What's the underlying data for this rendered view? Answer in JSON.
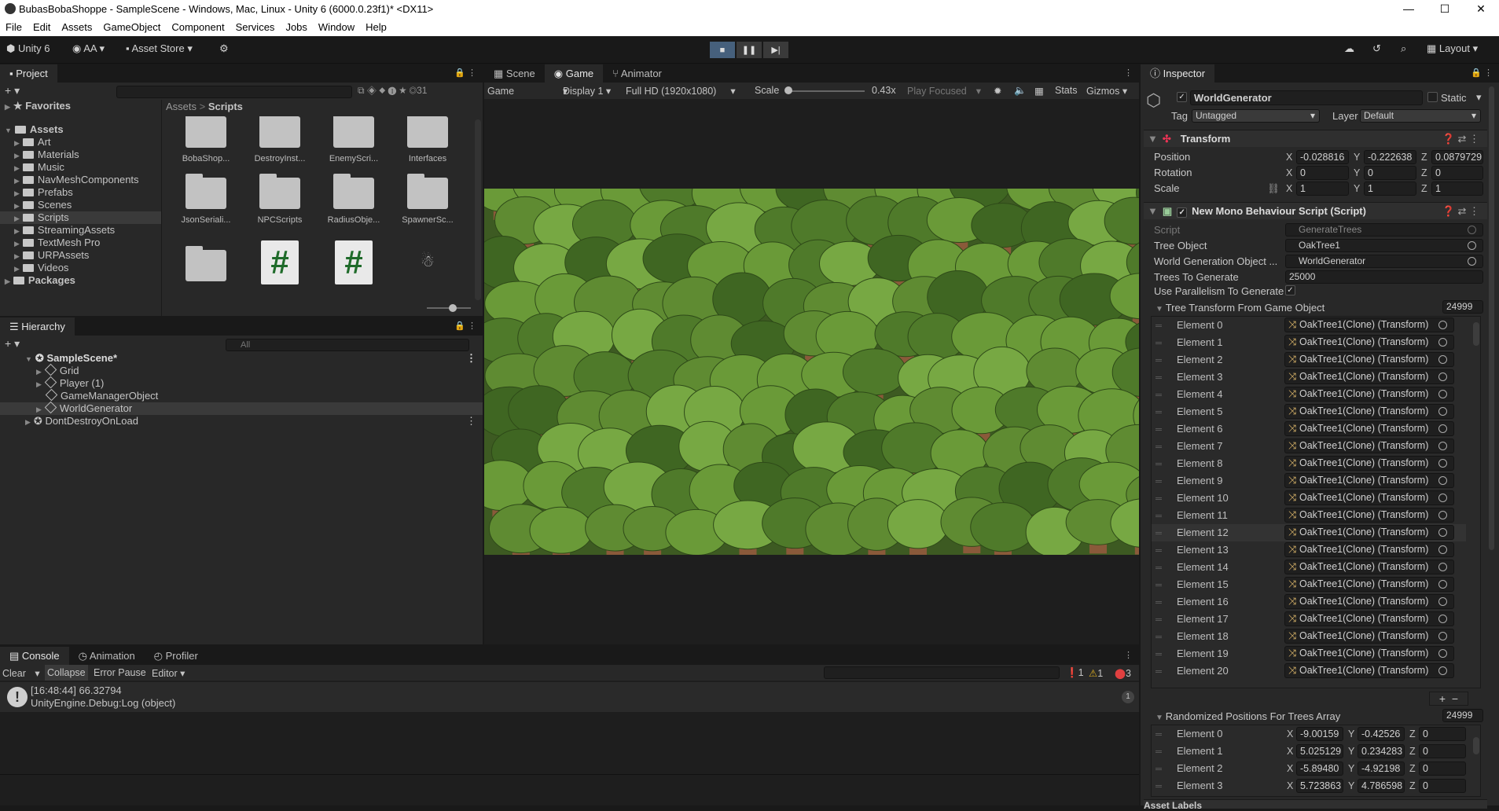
{
  "window": {
    "title": "BubasBobaShoppe - SampleScene - Windows, Mac, Linux - Unity 6 (6000.0.23f1)* <DX11>",
    "controls": [
      "—",
      "☐",
      "✕"
    ]
  },
  "menu": [
    "File",
    "Edit",
    "Assets",
    "GameObject",
    "Component",
    "Services",
    "Jobs",
    "Window",
    "Help"
  ],
  "toolbar": {
    "unity_label": "Unity 6",
    "account": "AA",
    "asset_store": "Asset Store",
    "layout": "Layout"
  },
  "project": {
    "tab": "Project",
    "favorites": "Favorites",
    "assets_root": "Assets",
    "folders": [
      "Art",
      "Materials",
      "Music",
      "NavMeshComponents",
      "Prefabs",
      "Scenes",
      "Scripts",
      "StreamingAssets",
      "TextMesh Pro",
      "URPAssets",
      "Videos"
    ],
    "packages": "Packages",
    "breadcrumb": [
      "Assets",
      "Scripts"
    ],
    "count": "31",
    "tiles": [
      "BobaShop...",
      "DestroyInst...",
      "EnemyScri...",
      "Interfaces",
      "JsonSeriali...",
      "NPCScripts",
      "RadiusObje...",
      "SpawnerSc..."
    ]
  },
  "hierarchy": {
    "tab": "Hierarchy",
    "search_placeholder": "All",
    "scene": "SampleScene*",
    "children": [
      "Grid",
      "Player (1)",
      "GameManagerObject",
      "WorldGenerator"
    ],
    "dont_destroy": "DontDestroyOnLoad"
  },
  "game": {
    "tabs": [
      "Scene",
      "Game",
      "Animator"
    ],
    "mode": "Game",
    "display": "Display 1",
    "resolution": "Full HD (1920x1080)",
    "scale_label": "Scale",
    "scale_value": "0.43x",
    "play_focused": "Play Focused",
    "stats": "Stats",
    "gizmos": "Gizmos"
  },
  "console": {
    "tabs": [
      "Console",
      "Animation",
      "Profiler"
    ],
    "buttons": [
      "Clear",
      "Collapse",
      "Error Pause",
      "Editor"
    ],
    "counts": {
      "info": "1",
      "warn": "1",
      "error": "3"
    },
    "log_line1": "[16:48:44] 66.32794",
    "log_line2": "UnityEngine.Debug:Log (object)",
    "log_count": "1"
  },
  "inspector": {
    "tab": "Inspector",
    "object_name": "WorldGenerator",
    "static": "Static",
    "tag_label": "Tag",
    "tag": "Untagged",
    "layer_label": "Layer",
    "layer": "Default",
    "transform": {
      "title": "Transform",
      "position": {
        "label": "Position",
        "x": "-0.028816",
        "y": "-0.222638",
        "z": "0.0879729"
      },
      "rotation": {
        "label": "Rotation",
        "x": "0",
        "y": "0",
        "z": "0"
      },
      "scale": {
        "label": "Scale",
        "x": "1",
        "y": "1",
        "z": "1"
      }
    },
    "script_comp": {
      "title": "New Mono Behaviour Script (Script)",
      "script_label": "Script",
      "script": "GenerateTrees",
      "tree_label": "Tree Object",
      "tree": "OakTree1",
      "world_label": "World Generation Object ...",
      "world": "WorldGenerator",
      "trees_label": "Trees To Generate",
      "trees": "25000",
      "parallel_label": "Use Parallelism To Generate"
    },
    "transform_list": {
      "label": "Tree Transform From Game Object",
      "size": "24999",
      "element_value": "OakTree1(Clone) (Transform)",
      "elements": [
        "Element 0",
        "Element 1",
        "Element 2",
        "Element 3",
        "Element 4",
        "Element 5",
        "Element 6",
        "Element 7",
        "Element 8",
        "Element 9",
        "Element 10",
        "Element 11",
        "Element 12",
        "Element 13",
        "Element 14",
        "Element 15",
        "Element 16",
        "Element 17",
        "Element 18",
        "Element 19",
        "Element 20"
      ]
    },
    "positions_list": {
      "label": "Randomized Positions For Trees Array",
      "size": "24999",
      "rows": [
        {
          "name": "Element 0",
          "x": "-9.00159",
          "y": "-0.42526",
          "z": "0"
        },
        {
          "name": "Element 1",
          "x": "5.025129",
          "y": "0.234283",
          "z": "0"
        },
        {
          "name": "Element 2",
          "x": "-5.89480",
          "y": "-4.92198",
          "z": "0"
        },
        {
          "name": "Element 3",
          "x": "5.723863",
          "y": "4.786598",
          "z": "0"
        }
      ]
    },
    "asset_labels": "Asset Labels"
  }
}
